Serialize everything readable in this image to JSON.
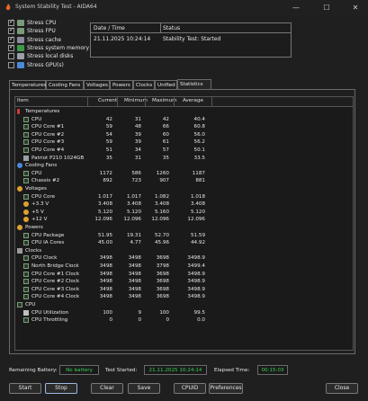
{
  "window": {
    "title": "System Stability Test - AIDA64",
    "minimize_glyph": "—",
    "maximize_glyph": "☐",
    "close_glyph": "✕"
  },
  "stress_options": [
    {
      "label": "Stress CPU",
      "checked": true,
      "icon": "cpu-icon",
      "color": "#7a9a7a"
    },
    {
      "label": "Stress FPU",
      "checked": true,
      "icon": "fpu-icon",
      "color": "#7a9a7a"
    },
    {
      "label": "Stress cache",
      "checked": true,
      "icon": "cache-icon",
      "color": "#8a8aa0"
    },
    {
      "label": "Stress system memory",
      "checked": true,
      "icon": "memory-icon",
      "color": "#3b9a4a"
    },
    {
      "label": "Stress local disks",
      "checked": false,
      "icon": "disk-icon",
      "color": "#9aa0a8"
    },
    {
      "label": "Stress GPU(s)",
      "checked": false,
      "icon": "gpu-icon",
      "color": "#4a8ad8"
    }
  ],
  "status_box": {
    "header_date": "Date / Time",
    "header_status": "Status",
    "date": "21.11.2025 10:24:14",
    "status": "Stability Test: Started"
  },
  "tabs": [
    "Temperatures",
    "Cooling Fans",
    "Voltages",
    "Powers",
    "Clocks",
    "Unified",
    "Statistics"
  ],
  "active_tab": "Statistics",
  "table": {
    "columns": [
      "Item",
      "Current",
      "Minimum",
      "Maximum",
      "Average"
    ],
    "rows": [
      {
        "type": "group",
        "label": "Temperatures",
        "icon": "thermometer-icon"
      },
      {
        "type": "item",
        "label": "CPU",
        "icon": "chip-icon",
        "cur": "42",
        "min": "31",
        "max": "42",
        "avg": "40.4"
      },
      {
        "type": "item",
        "label": "CPU Core #1",
        "icon": "chip-icon",
        "cur": "59",
        "min": "48",
        "max": "66",
        "avg": "60.8"
      },
      {
        "type": "item",
        "label": "CPU Core #2",
        "icon": "chip-icon",
        "cur": "54",
        "min": "39",
        "max": "60",
        "avg": "56.0"
      },
      {
        "type": "item",
        "label": "CPU Core #3",
        "icon": "chip-icon",
        "cur": "59",
        "min": "39",
        "max": "61",
        "avg": "56.2"
      },
      {
        "type": "item",
        "label": "CPU Core #4",
        "icon": "chip-icon",
        "cur": "51",
        "min": "34",
        "max": "57",
        "avg": "50.1"
      },
      {
        "type": "item",
        "label": "Patriot P210 1024GB",
        "icon": "disk-icon",
        "cur": "35",
        "min": "31",
        "max": "35",
        "avg": "33.5"
      },
      {
        "type": "group",
        "label": "Cooling Fans",
        "icon": "fan-icon"
      },
      {
        "type": "item",
        "label": "CPU",
        "icon": "chip-icon",
        "cur": "1172",
        "min": "586",
        "max": "1260",
        "avg": "1187"
      },
      {
        "type": "item",
        "label": "Chassis #2",
        "icon": "chip-icon",
        "cur": "892",
        "min": "723",
        "max": "907",
        "avg": "881"
      },
      {
        "type": "group",
        "label": "Voltages",
        "icon": "voltage-icon"
      },
      {
        "type": "item",
        "label": "CPU Core",
        "icon": "chip-icon",
        "cur": "1.017",
        "min": "1.017",
        "max": "1.082",
        "avg": "1.018"
      },
      {
        "type": "item",
        "label": "+3.3 V",
        "icon": "voltage-icon",
        "cur": "3.408",
        "min": "3.408",
        "max": "3.408",
        "avg": "3.408"
      },
      {
        "type": "item",
        "label": "+5 V",
        "icon": "voltage-icon",
        "cur": "5.120",
        "min": "5.120",
        "max": "5.160",
        "avg": "5.120"
      },
      {
        "type": "item",
        "label": "+12 V",
        "icon": "voltage-icon",
        "cur": "12.096",
        "min": "12.096",
        "max": "12.096",
        "avg": "12.096"
      },
      {
        "type": "group",
        "label": "Powers",
        "icon": "power-icon"
      },
      {
        "type": "item",
        "label": "CPU Package",
        "icon": "chip-icon",
        "cur": "51.95",
        "min": "19.31",
        "max": "52.70",
        "avg": "51.59"
      },
      {
        "type": "item",
        "label": "CPU IA Cores",
        "icon": "chip-icon",
        "cur": "45.00",
        "min": "4.77",
        "max": "45.96",
        "avg": "44.92"
      },
      {
        "type": "group",
        "label": "Clocks",
        "icon": "clock-icon"
      },
      {
        "type": "item",
        "label": "CPU Clock",
        "icon": "chip-icon",
        "cur": "3498",
        "min": "3498",
        "max": "3698",
        "avg": "3498.9"
      },
      {
        "type": "item",
        "label": "North Bridge Clock",
        "icon": "chip-icon",
        "cur": "3498",
        "min": "3498",
        "max": "3798",
        "avg": "3499.4"
      },
      {
        "type": "item",
        "label": "CPU Core #1 Clock",
        "icon": "chip-icon",
        "cur": "3498",
        "min": "3498",
        "max": "3698",
        "avg": "3498.9"
      },
      {
        "type": "item",
        "label": "CPU Core #2 Clock",
        "icon": "chip-icon",
        "cur": "3498",
        "min": "3498",
        "max": "3698",
        "avg": "3498.9"
      },
      {
        "type": "item",
        "label": "CPU Core #3 Clock",
        "icon": "chip-icon",
        "cur": "3498",
        "min": "3498",
        "max": "3698",
        "avg": "3498.9"
      },
      {
        "type": "item",
        "label": "CPU Core #4 Clock",
        "icon": "chip-icon",
        "cur": "3498",
        "min": "3498",
        "max": "3698",
        "avg": "3498.9"
      },
      {
        "type": "group",
        "label": "CPU",
        "icon": "chip-icon"
      },
      {
        "type": "item",
        "label": "CPU Utilization",
        "icon": "hourglass-icon",
        "cur": "100",
        "min": "9",
        "max": "100",
        "avg": "99.5"
      },
      {
        "type": "item",
        "label": "CPU Throttling",
        "icon": "chip-icon",
        "cur": "0",
        "min": "0",
        "max": "0",
        "avg": "0.0"
      }
    ]
  },
  "footer_info": {
    "battery_label": "Remaining Battery:",
    "battery_value": "No battery",
    "started_label": "Test Started:",
    "started_value": "21.11.2025 10:24:14",
    "elapsed_label": "Elapsed Time:",
    "elapsed_value": "00:15:03"
  },
  "buttons": {
    "start": "Start",
    "stop": "Stop",
    "clear": "Clear",
    "save": "Save",
    "cpuid": "CPUID",
    "preferences": "Preferences",
    "close": "Close"
  },
  "colors": {
    "accent_green": "#39d353",
    "background": "#1f1f1f"
  }
}
